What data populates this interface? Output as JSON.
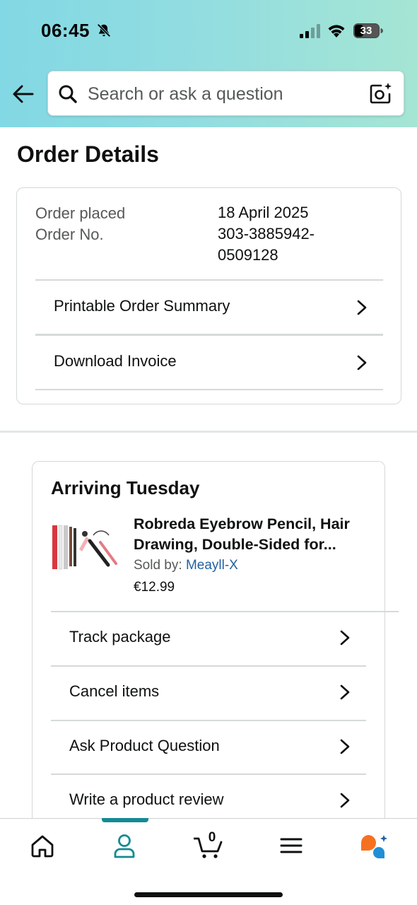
{
  "status_bar": {
    "time": "06:45",
    "battery": "33"
  },
  "search": {
    "placeholder": "Search or ask a question"
  },
  "page_title": "Order Details",
  "order": {
    "placed_label": "Order placed",
    "placed_value": "18 April 2025",
    "number_label": "Order No.",
    "number_value_line1": "303-3885942-",
    "number_value_line2": "0509128",
    "links": [
      "Printable Order Summary",
      "Download Invoice"
    ]
  },
  "shipment": {
    "heading": "Arriving Tuesday",
    "product_title": "Robreda Eyebrow Pencil, Hair Drawing, Double-Sided for...",
    "sold_by_label": "Sold by: ",
    "seller": "Meayll-X",
    "price": "€12.99",
    "actions": [
      "Track package",
      "Cancel items",
      "Ask Product Question",
      "Write a product review"
    ]
  },
  "bottom_nav": {
    "cart_count": "0",
    "items": [
      "home-icon",
      "account-icon",
      "cart-icon",
      "menu-icon",
      "rufus-icon"
    ],
    "accent": "#148a93"
  }
}
